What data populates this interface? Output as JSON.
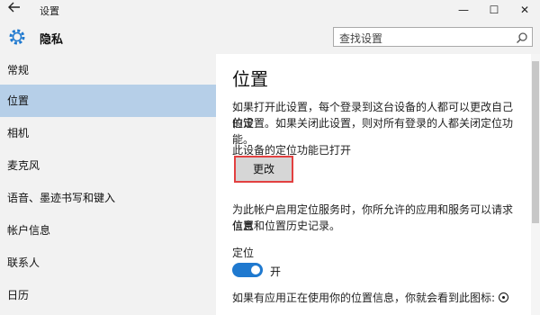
{
  "window": {
    "title": "设置",
    "back_icon": "back-arrow-icon",
    "min_glyph": "—",
    "max_glyph": "☐",
    "close_glyph": "✕"
  },
  "header": {
    "title": "隐私",
    "search_placeholder": "查找设置"
  },
  "sidebar": {
    "items": [
      {
        "label": "常规"
      },
      {
        "label": "位置"
      },
      {
        "label": "相机"
      },
      {
        "label": "麦克风"
      },
      {
        "label": "语音、墨迹书写和键入"
      },
      {
        "label": "帐户信息"
      },
      {
        "label": "联系人"
      },
      {
        "label": "日历"
      }
    ],
    "active_index": 1
  },
  "content": {
    "title": "位置",
    "intro_line1": "如果打开此设置，每个登录到这台设备的人都可以更改自己的定",
    "intro_line2": "位设置。如果关闭此设置，则对所有登录的人都关闭定位功能。",
    "device_status": "此设备的定位功能已打开",
    "change_button": "更改",
    "service_line1": "为此帐户启用定位服务时，你所允许的应用和服务可以请求位置",
    "service_line2": "信息和位置历史记录。",
    "location_label": "定位",
    "toggle_state": "开",
    "toggle_on": true,
    "icon_note": "如果有应用正在使用你的位置信息，你就会看到此图标:"
  },
  "colors": {
    "accent": "#1f79cf",
    "active_nav": "#b6cfe8",
    "highlight_border": "#e24040",
    "chrome_bg": "#f2f2f2"
  }
}
